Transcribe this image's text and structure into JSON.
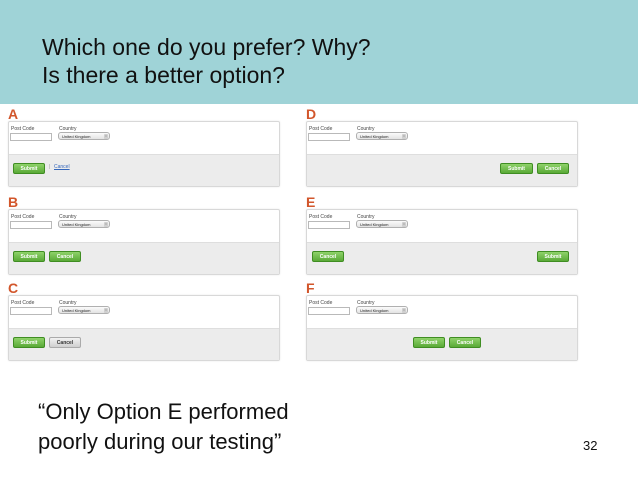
{
  "title": {
    "line1": "Which one do you prefer? Why?",
    "line2": "Is there a better option?"
  },
  "form": {
    "postcode_label": "Post Code",
    "country_label": "Country",
    "country_value": "United Kingdom",
    "select_arrow": "↕"
  },
  "variants": {
    "a": {
      "letter": "A",
      "submit": "Submit",
      "separator": "|",
      "cancel": "Cancel"
    },
    "b": {
      "letter": "B",
      "submit": "Submit",
      "cancel": "Cancel"
    },
    "c": {
      "letter": "C",
      "submit": "Submit",
      "cancel": "Cancel"
    },
    "d": {
      "letter": "D",
      "submit": "Submit",
      "cancel": "Cancel"
    },
    "e": {
      "letter": "E",
      "submit": "Submit",
      "cancel": "Cancel"
    },
    "f": {
      "letter": "F",
      "submit": "Submit",
      "cancel": "Cancel"
    }
  },
  "quote": {
    "line1": "“Only Option E performed",
    "line2": "poorly during our testing”"
  },
  "slide_number": "32",
  "colors": {
    "banner": "#9fd3d7",
    "letter": "#d2562b",
    "primary_button": "#6dbb45",
    "secondary_button": "#d9d9d9",
    "link": "#3366bb"
  }
}
